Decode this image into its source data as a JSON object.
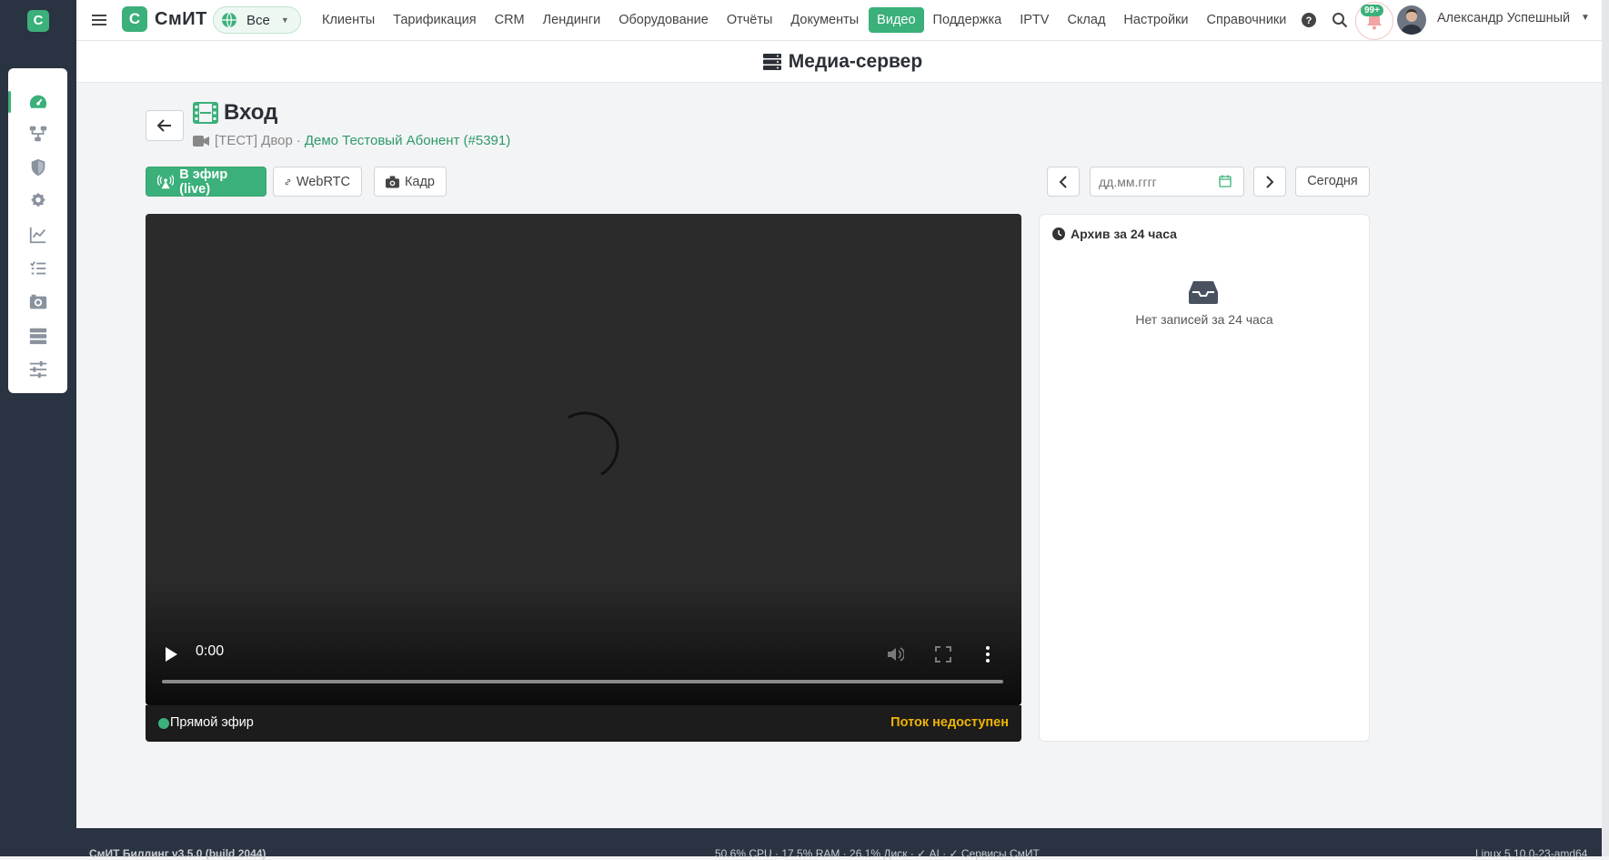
{
  "app": {
    "logo_letter": "С",
    "brand": "СмИТ",
    "scope_label": "Все"
  },
  "nav": [
    {
      "label": "Клиенты"
    },
    {
      "label": "Тарификация"
    },
    {
      "label": "CRM"
    },
    {
      "label": "Лендинги"
    },
    {
      "label": "Оборудование"
    },
    {
      "label": "Отчёты"
    },
    {
      "label": "Документы"
    },
    {
      "label": "Видео",
      "active": true
    },
    {
      "label": "Поддержка"
    },
    {
      "label": "IPTV"
    },
    {
      "label": "Склад"
    },
    {
      "label": "Настройки"
    },
    {
      "label": "Справочники"
    }
  ],
  "notifications": {
    "badge": "99+"
  },
  "user": {
    "name": "Александр Успешный"
  },
  "sidebar_icons": [
    "dashboard-icon",
    "network-icon",
    "shield-icon",
    "badge-icon",
    "chart-icon",
    "tasks-icon",
    "camera-icon",
    "server-icon",
    "sliders-icon"
  ],
  "section_title": "Медиа-сервер",
  "page": {
    "title": "Вход",
    "sub_prefix": "[ТЕСТ] Двор",
    "sub_sep": "·",
    "sub_link": "Демо Тестовый Абонент (#5391)"
  },
  "actions": {
    "live": "В эфир (live)",
    "webrtc": "WebRTC",
    "frame": "Кадр"
  },
  "date": {
    "placeholder": "дд.мм.гггг",
    "today": "Сегодня"
  },
  "player": {
    "time": "0:00",
    "live_label": "Прямой эфир",
    "stream_status": "Поток недоступен"
  },
  "archive": {
    "title": "Архив за 24 часа",
    "empty": "Нет записей за 24 часа"
  },
  "footer": {
    "version": "СмИТ Биллинг v3.5.0 (build 2044)",
    "stats": "50.6% CPU · 17.5% RAM · 26.1% Диск · ✓ AI · ✓ Сервисы СмИТ",
    "os": "Linux 5.10.0-23-amd64"
  },
  "colors": {
    "accent": "#3bb07a",
    "dark": "#2a3341",
    "warning": "#f0b400"
  }
}
